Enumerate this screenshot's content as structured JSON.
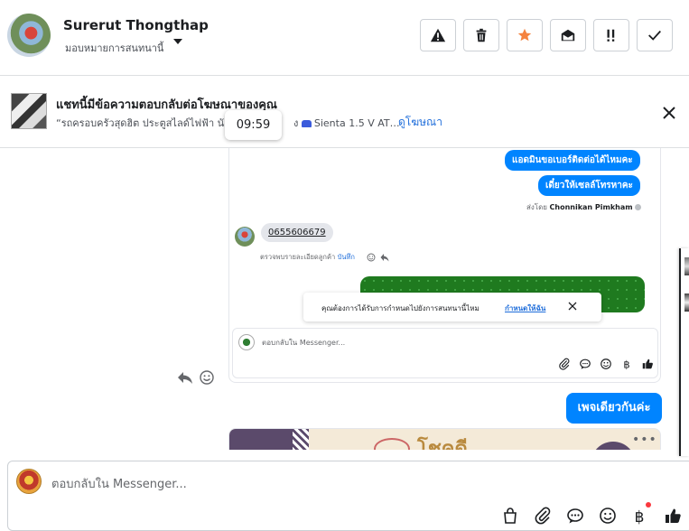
{
  "header": {
    "user_name": "Surerut Thongthap",
    "assign_label": "มอบหมายการสนทนานี้",
    "actions": [
      {
        "name": "report-spam-button",
        "icon": "warning-icon"
      },
      {
        "name": "delete-button",
        "icon": "trash-icon"
      },
      {
        "name": "star-button",
        "icon": "star-icon"
      },
      {
        "name": "mark-unread-button",
        "icon": "envelope-open-icon"
      },
      {
        "name": "follow-up-button",
        "icon": "exclamation-icon"
      },
      {
        "name": "mark-done-button",
        "icon": "check-icon"
      }
    ]
  },
  "ad_banner": {
    "title": "แชทนี้มีข้อความตอบกลับต่อโฆษณาของคุณ",
    "desc_left": "“รถครอบครัวสุดฮิต ประตูสไลด์ไฟฟ้า นั",
    "desc_right": "ง",
    "car_model": "Sienta 1.5 V AT…",
    "view_ad_link": "ดูโฆษณา"
  },
  "timer": "09:59",
  "thread": {
    "screenshot": {
      "bubble1": "แอดมินขอเบอร์ติดต่อได้ไหมคะ",
      "bubble2": "เดี๋ยวให้เซลล์โทรหาคะ",
      "sent_by_prefix": "ส่งโดย",
      "sent_by_name": "Chonnikan Pimkham",
      "phone": "0655606679",
      "check_note": "ตรวจพบรายละเอียดลูกค้า",
      "check_note_link": "บันทึก",
      "notice_text": "คุณต้องการได้รับการกำหนดไปยังการสนทนานี้ไหม",
      "notice_link": "กำหนดให้ฉัน",
      "composer_placeholder": "ตอบกลับใน Messenger..."
    },
    "sent_message": "เพจเดียวกันค่ะ",
    "image_card_more": "•••",
    "image_card_text": "โชคดี"
  },
  "composer": {
    "placeholder": "ตอบกลับใน Messenger...",
    "tools": [
      "bag-icon",
      "attachment-icon",
      "saved-reply-icon",
      "emoji-icon",
      "baht-icon",
      "like-icon"
    ]
  },
  "colors": {
    "accent": "#0084ff",
    "link": "#216fdb",
    "star": "#f5833f"
  }
}
